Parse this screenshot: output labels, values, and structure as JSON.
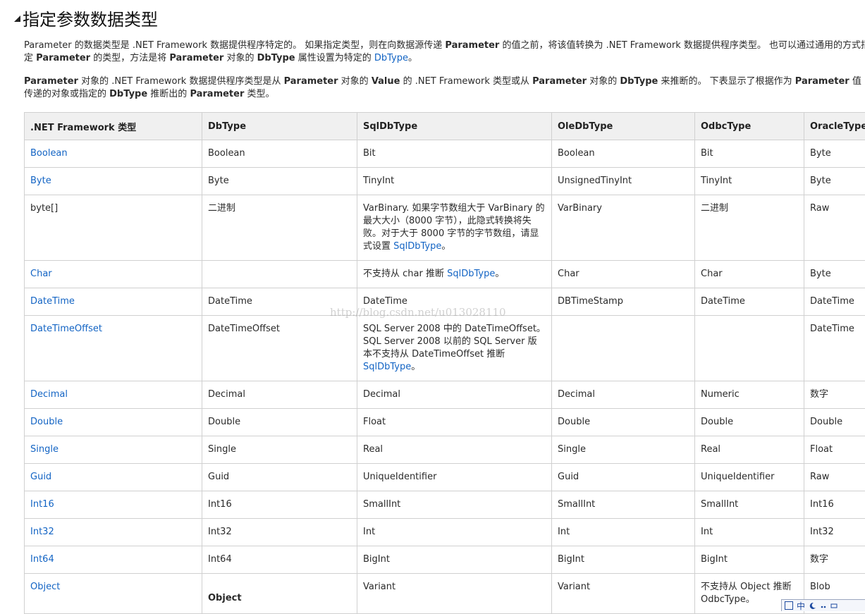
{
  "heading": "指定参数数据类型",
  "para1": {
    "t1": "Parameter 的数据类型是 .NET Framework 数据提供程序特定的。 如果指定类型，则在向数据源传递 ",
    "b1": "Parameter",
    "t2": " 的值之前，将该值转换为 .NET Framework 数据提供程序类型。 也可以通过通用的方式指定 ",
    "b2": "Parameter",
    "t3": " 的类型，方法是将 ",
    "b3": "Parameter",
    "t4": " 对象的 ",
    "b4": "DbType",
    "t5": " 属性设置为特定的 ",
    "link": "DbType",
    "t6": "。"
  },
  "para2": {
    "b1": "Parameter",
    "t1": " 对象的 .NET Framework 数据提供程序类型是从 ",
    "b2": "Parameter",
    "t2": " 对象的 ",
    "b3": "Value",
    "t3": " 的 .NET Framework 类型或从 ",
    "b4": "Parameter",
    "t4": " 对象的 ",
    "b5": "DbType",
    "t5": " 来推断的。 下表显示了根据作为 ",
    "b6": "Parameter",
    "t6": " 值传递的对象或指定的 ",
    "b7": "DbType",
    "t7": " 推断出的 ",
    "b8": "Parameter",
    "t8": " 类型。"
  },
  "table": {
    "headers": [
      ".NET Framework 类型",
      "DbType",
      "SqlDbType",
      "OleDbType",
      "OdbcType",
      "OracleType"
    ],
    "rows": [
      {
        "net": "Boolean",
        "db": "Boolean",
        "sql": "Bit",
        "ole": "Boolean",
        "odbc": "Bit",
        "ora": "Byte"
      },
      {
        "net": "Byte",
        "db": "Byte",
        "sql": "TinyInt",
        "ole": "UnsignedTinyInt",
        "odbc": "TinyInt",
        "ora": "Byte"
      },
      {
        "net": "byte[]",
        "db": "二进制",
        "sql": "VarBinary. 如果字节数组大于 VarBinary 的最大大小（8000 字节），此隐式转换将失败。对于大于 8000 字节的字节数组，请显式设置 ",
        "sql_link": "SqlDbType",
        "sql_tail": "。",
        "ole": "VarBinary",
        "odbc": "二进制",
        "ora": "Raw"
      },
      {
        "net": "Char",
        "db": "",
        "sql": "不支持从 char 推断 ",
        "sql_link": "SqlDbType",
        "sql_tail": "。",
        "ole": "Char",
        "odbc": "Char",
        "ora": "Byte"
      },
      {
        "net": "DateTime",
        "db": "DateTime",
        "sql": "DateTime",
        "ole": "DBTimeStamp",
        "odbc": "DateTime",
        "ora": "DateTime"
      },
      {
        "net": "DateTimeOffset",
        "db": "DateTimeOffset",
        "sql": "SQL Server 2008 中的 DateTimeOffset。SQL Server 2008 以前的 SQL Server 版本不支持从 DateTimeOffset 推断 ",
        "sql_link": "SqlDbType",
        "sql_tail": "。",
        "ole": "",
        "odbc": "",
        "ora": "DateTime"
      },
      {
        "net": "Decimal",
        "db": "Decimal",
        "sql": "Decimal",
        "ole": "Decimal",
        "odbc": "Numeric",
        "ora": "数字"
      },
      {
        "net": "Double",
        "db": "Double",
        "sql": "Float",
        "ole": "Double",
        "odbc": "Double",
        "ora": "Double"
      },
      {
        "net": "Single",
        "db": "Single",
        "sql": "Real",
        "ole": "Single",
        "odbc": "Real",
        "ora": "Float"
      },
      {
        "net": "Guid",
        "db": "Guid",
        "sql": "UniqueIdentifier",
        "ole": "Guid",
        "odbc": "UniqueIdentifier",
        "ora": "Raw"
      },
      {
        "net": "Int16",
        "db": "Int16",
        "sql": "SmallInt",
        "ole": "SmallInt",
        "odbc": "SmallInt",
        "ora": "Int16"
      },
      {
        "net": "Int32",
        "db": "Int32",
        "sql": "Int",
        "ole": "Int",
        "odbc": "Int",
        "ora": "Int32"
      },
      {
        "net": "Int64",
        "db": "Int64",
        "sql": "BigInt",
        "ole": "BigInt",
        "odbc": "BigInt",
        "ora": "数字"
      },
      {
        "net": "Object",
        "db": "Object",
        "sql": "Variant",
        "ole": "Variant",
        "odbc": "不支持从 Object 推断 OdbcType。",
        "ora": "Blob"
      }
    ]
  },
  "watermark": "http://blog.csdn.net/u013028110",
  "ime": {
    "label": "中"
  },
  "colors": {
    "link": "#1364c4",
    "header_bg": "#f0f0f0",
    "border": "#d0d0d0"
  }
}
